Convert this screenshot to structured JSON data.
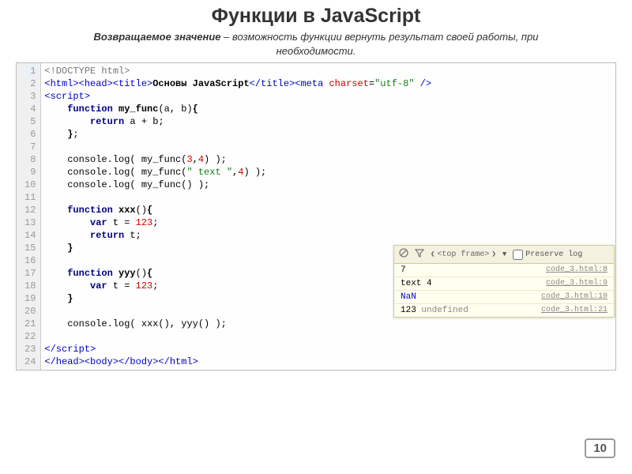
{
  "title": "Функции в JavaScript",
  "subtitle_strong": "Возвращаемое значение",
  "subtitle_rest": " – возможность функции вернуть результат своей работы, при необходимости.",
  "code_lines": [
    {
      "n": 1,
      "hl": true,
      "segs": [
        {
          "c": "c-doct",
          "t": "<!DOCTYPE html>"
        }
      ]
    },
    {
      "n": 2,
      "segs": [
        {
          "c": "c-tag",
          "t": "<html><head><title>"
        },
        {
          "c": "c-fn",
          "t": "Основы JavaScript"
        },
        {
          "c": "c-tag",
          "t": "</title><meta "
        },
        {
          "c": "c-attr",
          "t": "charset"
        },
        {
          "c": "",
          "t": "="
        },
        {
          "c": "c-str",
          "t": "\"utf-8\""
        },
        {
          "c": "c-tag",
          "t": " />"
        }
      ]
    },
    {
      "n": 3,
      "segs": [
        {
          "c": "c-tag",
          "t": "<script>"
        }
      ]
    },
    {
      "n": 4,
      "segs": [
        {
          "c": "",
          "t": "    "
        },
        {
          "c": "c-key",
          "t": "function"
        },
        {
          "c": "",
          "t": " "
        },
        {
          "c": "c-fn",
          "t": "my_func"
        },
        {
          "c": "",
          "t": "(a, b)"
        },
        {
          "c": "c-fn",
          "t": "{"
        }
      ]
    },
    {
      "n": 5,
      "segs": [
        {
          "c": "",
          "t": "        "
        },
        {
          "c": "c-key",
          "t": "return"
        },
        {
          "c": "",
          "t": " a + b;"
        }
      ]
    },
    {
      "n": 6,
      "segs": [
        {
          "c": "",
          "t": "    "
        },
        {
          "c": "c-fn",
          "t": "}"
        },
        {
          "c": "",
          "t": ";"
        }
      ]
    },
    {
      "n": 7,
      "segs": [
        {
          "c": "",
          "t": ""
        }
      ]
    },
    {
      "n": 8,
      "segs": [
        {
          "c": "",
          "t": "    console.log( my_func("
        },
        {
          "c": "c-num",
          "t": "3"
        },
        {
          "c": "",
          "t": ","
        },
        {
          "c": "c-num",
          "t": "4"
        },
        {
          "c": "",
          "t": ") );"
        }
      ]
    },
    {
      "n": 9,
      "segs": [
        {
          "c": "",
          "t": "    console.log( my_func("
        },
        {
          "c": "c-str",
          "t": "\" text \""
        },
        {
          "c": "",
          "t": ","
        },
        {
          "c": "c-num",
          "t": "4"
        },
        {
          "c": "",
          "t": ") );"
        }
      ]
    },
    {
      "n": 10,
      "segs": [
        {
          "c": "",
          "t": "    console.log( my_func() );"
        }
      ]
    },
    {
      "n": 11,
      "segs": [
        {
          "c": "",
          "t": ""
        }
      ]
    },
    {
      "n": 12,
      "segs": [
        {
          "c": "",
          "t": "    "
        },
        {
          "c": "c-key",
          "t": "function"
        },
        {
          "c": "",
          "t": " "
        },
        {
          "c": "c-fn",
          "t": "xxx"
        },
        {
          "c": "",
          "t": "()"
        },
        {
          "c": "c-fn",
          "t": "{"
        }
      ]
    },
    {
      "n": 13,
      "segs": [
        {
          "c": "",
          "t": "        "
        },
        {
          "c": "c-key",
          "t": "var"
        },
        {
          "c": "",
          "t": " t = "
        },
        {
          "c": "c-num",
          "t": "123"
        },
        {
          "c": "",
          "t": ";"
        }
      ]
    },
    {
      "n": 14,
      "segs": [
        {
          "c": "",
          "t": "        "
        },
        {
          "c": "c-key",
          "t": "return"
        },
        {
          "c": "",
          "t": " t;"
        }
      ]
    },
    {
      "n": 15,
      "segs": [
        {
          "c": "",
          "t": "    "
        },
        {
          "c": "c-fn",
          "t": "}"
        }
      ]
    },
    {
      "n": 16,
      "segs": [
        {
          "c": "",
          "t": ""
        }
      ]
    },
    {
      "n": 17,
      "segs": [
        {
          "c": "",
          "t": "    "
        },
        {
          "c": "c-key",
          "t": "function"
        },
        {
          "c": "",
          "t": " "
        },
        {
          "c": "c-fn",
          "t": "yyy"
        },
        {
          "c": "",
          "t": "()"
        },
        {
          "c": "c-fn",
          "t": "{"
        }
      ]
    },
    {
      "n": 18,
      "segs": [
        {
          "c": "",
          "t": "        "
        },
        {
          "c": "c-key",
          "t": "var"
        },
        {
          "c": "",
          "t": " t = "
        },
        {
          "c": "c-num",
          "t": "123"
        },
        {
          "c": "",
          "t": ";"
        }
      ]
    },
    {
      "n": 19,
      "segs": [
        {
          "c": "",
          "t": "    "
        },
        {
          "c": "c-fn",
          "t": "}"
        }
      ]
    },
    {
      "n": 20,
      "segs": [
        {
          "c": "",
          "t": ""
        }
      ]
    },
    {
      "n": 21,
      "segs": [
        {
          "c": "",
          "t": "    console.log( xxx(), yyy() );"
        }
      ]
    },
    {
      "n": 22,
      "segs": [
        {
          "c": "",
          "t": ""
        }
      ]
    },
    {
      "n": 23,
      "segs": [
        {
          "c": "c-tag",
          "t": "</script>"
        }
      ]
    },
    {
      "n": 24,
      "segs": [
        {
          "c": "c-tag",
          "t": "</head><body></body></html>"
        }
      ]
    }
  ],
  "console": {
    "frame_label": "<top frame>",
    "preserve_label": "Preserve log",
    "rows": [
      {
        "out": "7",
        "cls": "",
        "src": "code_3.html:8"
      },
      {
        "out": " text 4",
        "cls": "",
        "src": "code_3.html:9"
      },
      {
        "out": "NaN",
        "cls": "nan",
        "src": "code_3.html:10"
      },
      {
        "out": "123 ",
        "out2": "undefined",
        "cls2": "undef",
        "src": "code_3.html:21"
      }
    ]
  },
  "page_number": "10"
}
